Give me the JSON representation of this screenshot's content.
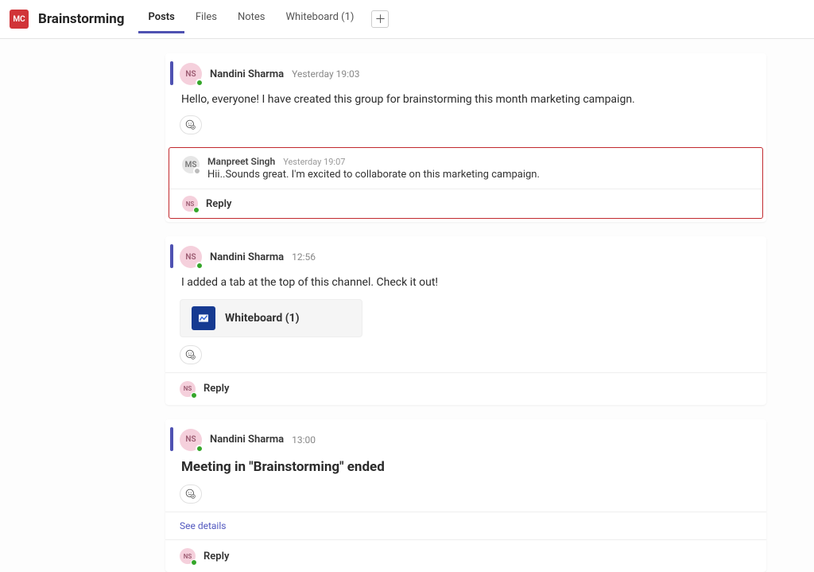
{
  "workspace": {
    "initials": "MC"
  },
  "channel": {
    "title": "Brainstorming"
  },
  "tabs": {
    "items": [
      "Posts",
      "Files",
      "Notes",
      "Whiteboard (1)"
    ],
    "activeIndex": 0
  },
  "reply_label": "Reply",
  "posts": [
    {
      "author": {
        "name": "Nandini Sharma",
        "initials": "NS",
        "presence": "online"
      },
      "timestamp": "Yesterday 19:03",
      "message": "Hello, everyone! I have created this group for brainstorming this month marketing campaign.",
      "highlighted_reply": {
        "author": {
          "name": "Manpreet Singh",
          "initials": "MS",
          "presence": "offline"
        },
        "timestamp": "Yesterday 19:07",
        "message": "Hii..Sounds great. I'm excited to collaborate on this marketing campaign."
      }
    },
    {
      "author": {
        "name": "Nandini Sharma",
        "initials": "NS",
        "presence": "online"
      },
      "timestamp": "12:56",
      "message": "I added a tab at the top of this channel. Check it out!",
      "tab_attachment": {
        "label": "Whiteboard (1)"
      }
    },
    {
      "author": {
        "name": "Nandini Sharma",
        "initials": "NS",
        "presence": "online"
      },
      "timestamp": "13:00",
      "headline": "Meeting in \"Brainstorming\" ended",
      "see_details": "See details"
    }
  ]
}
